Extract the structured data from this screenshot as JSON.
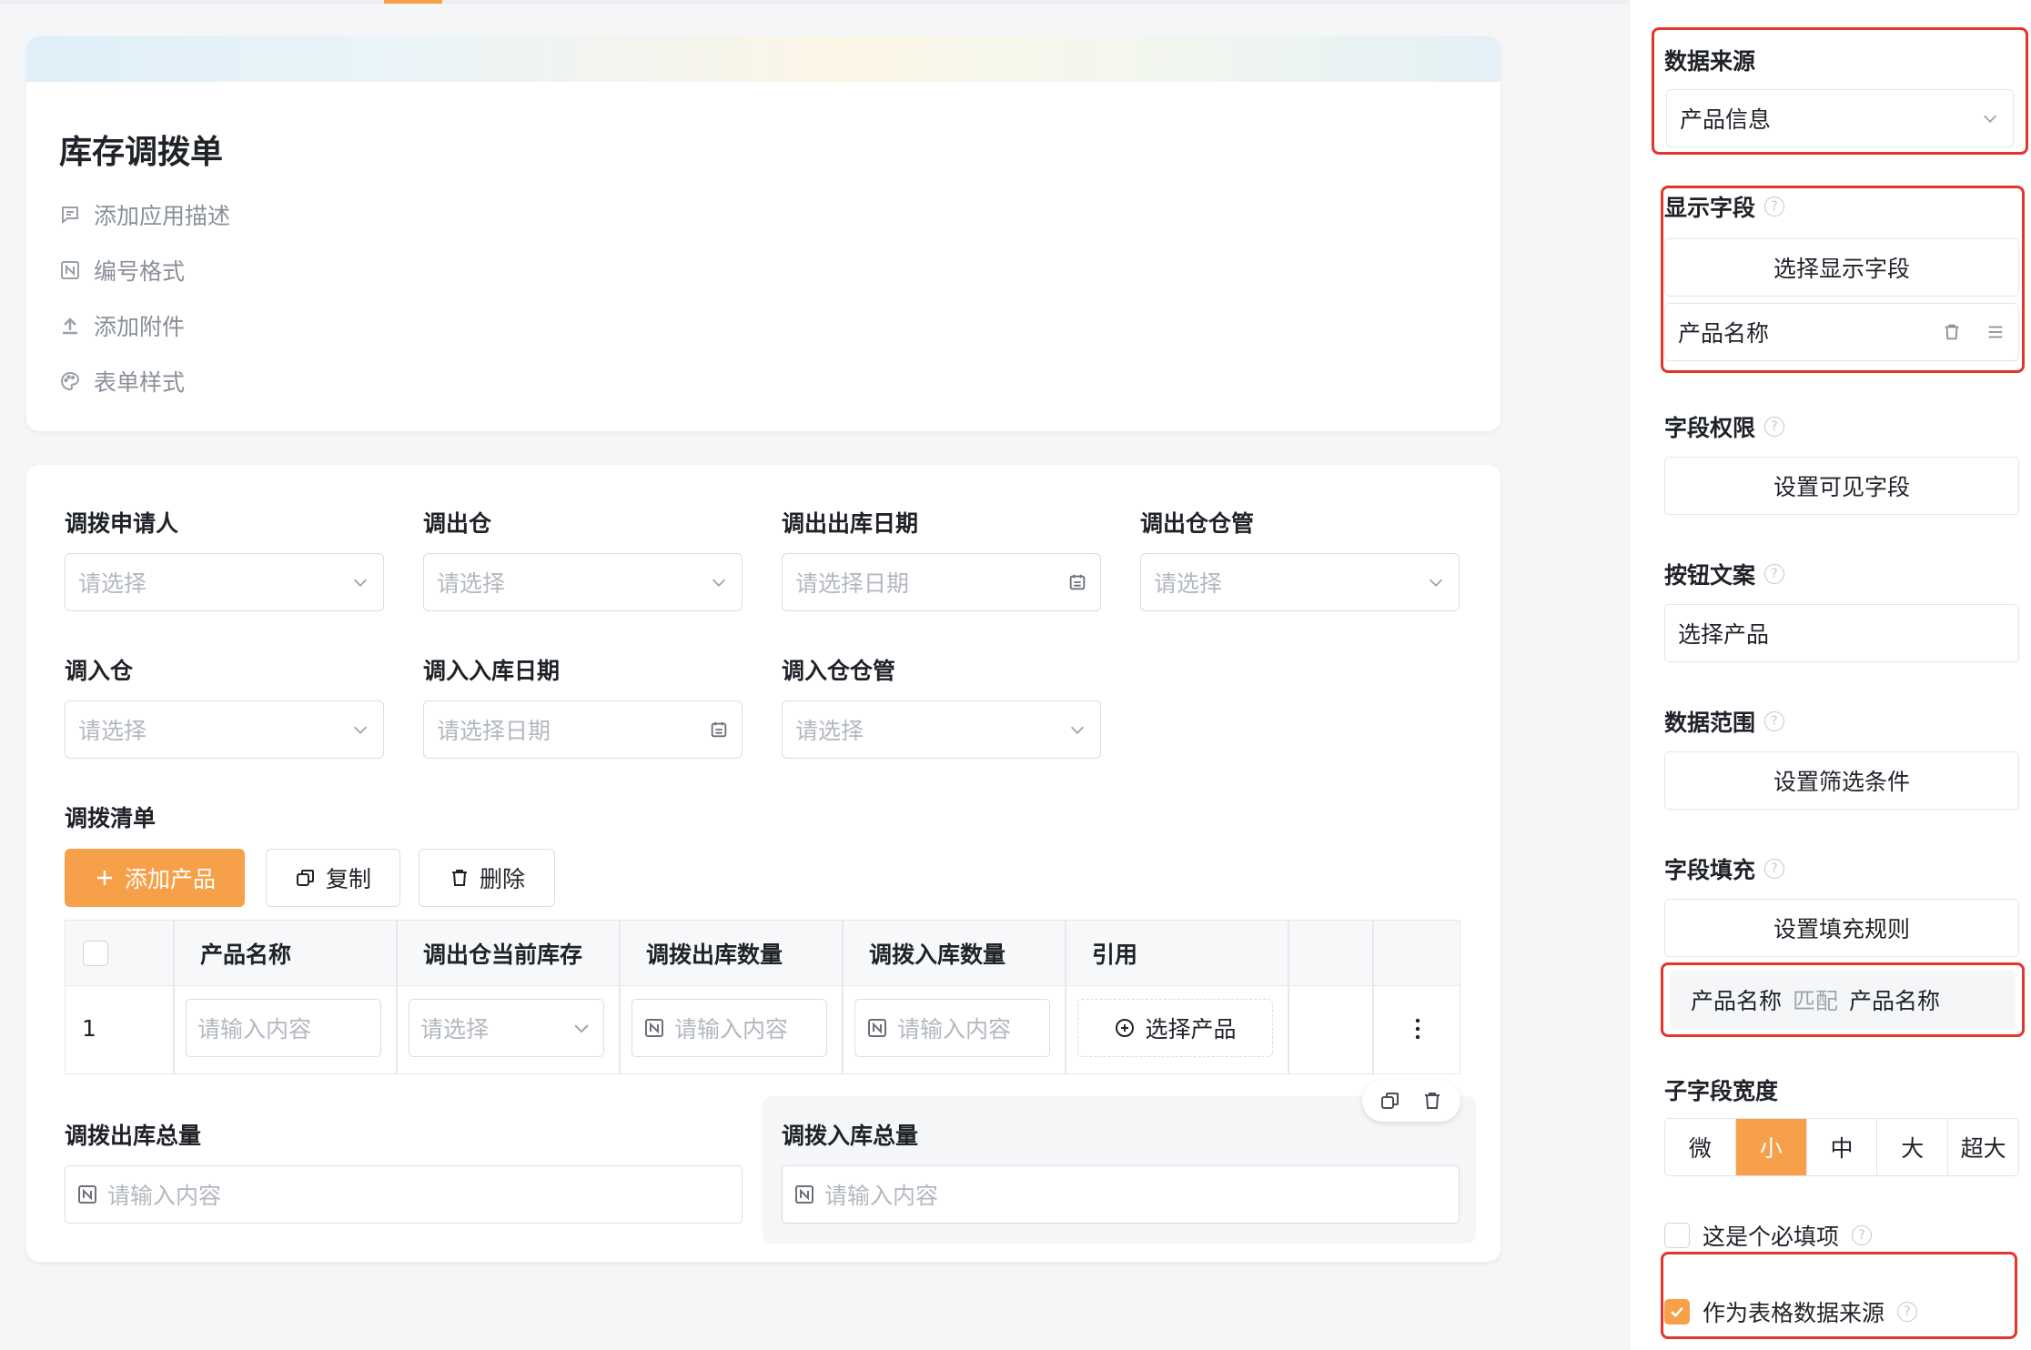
{
  "colors": {
    "accent": "#f7a04a",
    "highlight_frame": "#e5342b",
    "placeholder": "#b3b8c0"
  },
  "header": {
    "title": "库存调拨单",
    "meta": [
      {
        "icon": "comment-icon",
        "label": "添加应用描述"
      },
      {
        "icon": "number-format-icon",
        "label": "编号格式"
      },
      {
        "icon": "upload-icon",
        "label": "添加附件"
      },
      {
        "icon": "palette-icon",
        "label": "表单样式"
      }
    ]
  },
  "form": {
    "fields": {
      "applicant": {
        "label": "调拨申请人",
        "placeholder": "请选择"
      },
      "out_warehouse": {
        "label": "调出仓",
        "placeholder": "请选择"
      },
      "out_date": {
        "label": "调出出库日期",
        "placeholder": "请选择日期"
      },
      "out_keeper": {
        "label": "调出仓仓管",
        "placeholder": "请选择"
      },
      "in_warehouse": {
        "label": "调入仓",
        "placeholder": "请选择"
      },
      "in_date": {
        "label": "调入入库日期",
        "placeholder": "请选择日期"
      },
      "in_keeper": {
        "label": "调入仓仓管",
        "placeholder": "请选择"
      }
    },
    "list": {
      "label": "调拨清单",
      "add_button": "添加产品",
      "copy_button": "复制",
      "delete_button": "删除",
      "columns": [
        "产品名称",
        "调出仓当前库存",
        "调拨出库数量",
        "调拨入库数量",
        "引用"
      ],
      "row": {
        "index": "1",
        "name_placeholder": "请输入内容",
        "stock_placeholder": "请选择",
        "out_qty_placeholder": "请输入内容",
        "in_qty_placeholder": "请输入内容",
        "ref_button": "选择产品"
      }
    },
    "totals": {
      "out_total": {
        "label": "调拨出库总量",
        "placeholder": "请输入内容"
      },
      "in_total": {
        "label": "调拨入库总量",
        "placeholder": "请输入内容"
      }
    }
  },
  "panel": {
    "data_source": {
      "label": "数据来源",
      "value": "产品信息"
    },
    "display_fields": {
      "label": "显示字段",
      "button": "选择显示字段",
      "item": "产品名称"
    },
    "field_permission": {
      "label": "字段权限",
      "button": "设置可见字段"
    },
    "button_text": {
      "label": "按钮文案",
      "value": "选择产品"
    },
    "data_range": {
      "label": "数据范围",
      "button": "设置筛选条件"
    },
    "field_fill": {
      "label": "字段填充",
      "button": "设置填充规则",
      "rule_left": "产品名称",
      "rule_mid": "匹配",
      "rule_right": "产品名称"
    },
    "subfield_width": {
      "label": "子字段宽度",
      "options": [
        "微",
        "小",
        "中",
        "大",
        "超大"
      ],
      "selected": "小"
    },
    "required": {
      "label": "这是个必填项",
      "checked": false
    },
    "as_table_source": {
      "label": "作为表格数据来源",
      "checked": true
    }
  }
}
